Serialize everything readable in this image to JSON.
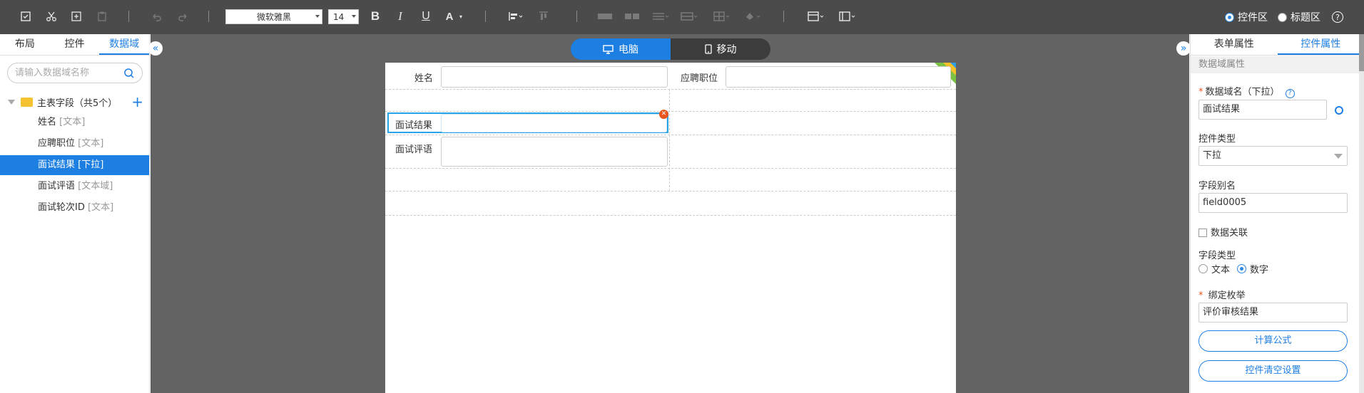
{
  "toolbar": {
    "font_family": "微软雅黑",
    "font_size": "14",
    "bold": "B",
    "italic": "I",
    "underline": "U",
    "font_color": "A",
    "control_area_label": "控件区",
    "title_area_label": "标题区",
    "help": "?"
  },
  "left_panel": {
    "tabs": [
      "布局",
      "控件",
      "数据域"
    ],
    "search_placeholder": "请输入数据域名称",
    "group_label": "主表字段（共5个）",
    "items": [
      {
        "name": "姓名",
        "type": "[文本]"
      },
      {
        "name": "应聘职位",
        "type": "[文本]"
      },
      {
        "name": "面试结果",
        "type": "[下拉]"
      },
      {
        "name": "面试评语",
        "type": "[文本域]"
      },
      {
        "name": "面试轮次ID",
        "type": "[文本]"
      }
    ]
  },
  "canvas": {
    "device_toggle": {
      "desktop": "电脑",
      "mobile": "移动"
    },
    "form": {
      "name_label": "姓名",
      "position_label": "应聘职位",
      "result_label": "面试结果",
      "comment_label": "面试评语"
    }
  },
  "right_panel": {
    "tabs": [
      "表单属性",
      "控件属性"
    ],
    "section_title": "数据域属性",
    "data_field_name_label": "数据域名（下拉）",
    "data_field_name_value": "面试结果",
    "control_type_label": "控件类型",
    "control_type_value": "下拉",
    "field_alias_label": "字段别名",
    "field_alias_value": "field0005",
    "data_link_label": "数据关联",
    "field_type_label": "字段类型",
    "field_type_text": "文本",
    "field_type_number": "数字",
    "bind_enum_label": "绑定枚举",
    "bind_enum_value": "评价审核结果",
    "calc_formula_button": "计算公式",
    "clear_settings_button": "控件清空设置"
  },
  "colors": {
    "accent": "#1e7fe2",
    "toolbar_bg": "#4b4b4b",
    "canvas_bg": "#636363",
    "required": "#e8541d"
  }
}
